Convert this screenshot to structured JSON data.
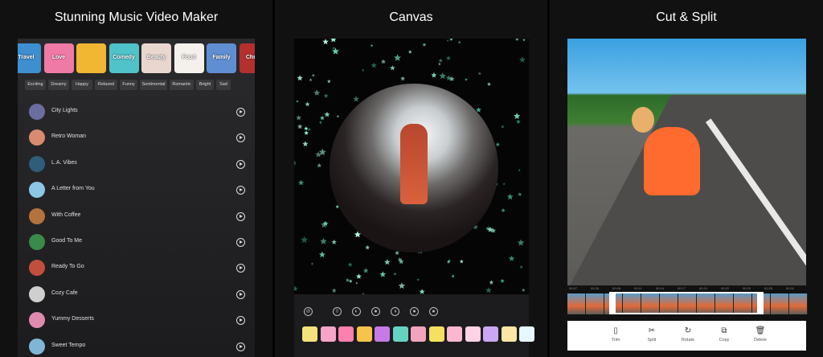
{
  "panels": {
    "music": {
      "title": "Stunning Music Video Maker",
      "categories": [
        {
          "label": "Travel",
          "color": "#3d8fd0"
        },
        {
          "label": "Love",
          "color": "#f07aa6"
        },
        {
          "label": "",
          "color": "#f1b732"
        },
        {
          "label": "Comedy",
          "color": "#4fc3c9"
        },
        {
          "label": "Beauty",
          "color": "#e9d7cf"
        },
        {
          "label": "Food",
          "color": "#f4f1ec"
        },
        {
          "label": "Family",
          "color": "#5f8fd2"
        },
        {
          "label": "Christ",
          "color": "#b52f2f"
        }
      ],
      "moods": [
        "Exciting",
        "Dreamy",
        "Happy",
        "Relaxed",
        "Funny",
        "Sentimental",
        "Romantic",
        "Bright",
        "Sad"
      ],
      "songs": [
        {
          "title": "City Lights",
          "color": "#6a6f9f"
        },
        {
          "title": "Retro Woman",
          "color": "#d98b71"
        },
        {
          "title": "L.A. Vibes",
          "color": "#2f5d7a"
        },
        {
          "title": "A Letter from You",
          "color": "#8cc8e6"
        },
        {
          "title": "With Coffee",
          "color": "#b3733d"
        },
        {
          "title": "Good To Me",
          "color": "#3a8a4a"
        },
        {
          "title": "Ready To Go",
          "color": "#c24f3d"
        },
        {
          "title": "Cozy Cafe",
          "color": "#cfcfcf"
        },
        {
          "title": "Yummy Desserts",
          "color": "#e08ab0"
        },
        {
          "title": "Sweet Tempo",
          "color": "#7fb6d6"
        }
      ]
    },
    "canvas": {
      "title": "Canvas",
      "tools": [
        "none-icon",
        "drop-icon",
        "half-circle-icon",
        "circle-icon",
        "half-moon-icon",
        "dot-icon",
        "dot-icon-2"
      ],
      "swatches": [
        "#f4e27a",
        "#f8a4c8",
        "#ff7fae",
        "#f7c44a",
        "#c779e6",
        "#66d3c2",
        "#f2a3bd",
        "#f5e15e",
        "#fbb7cf",
        "#ffd2e4",
        "#c9a7f2",
        "#fbe6a3",
        "#e7f7ff"
      ]
    },
    "cut": {
      "title": "Cut & Split",
      "timeline_times": [
        "00:07",
        "00:26",
        "00:08",
        "00:11",
        "00:14",
        "00:17",
        "00:19",
        "00:22",
        "00:25",
        "00:28",
        "00:31"
      ],
      "actions": [
        {
          "label": "Trim",
          "icon": "trim-icon",
          "glyph": "▯"
        },
        {
          "label": "Split",
          "icon": "scissors-icon",
          "glyph": "✂"
        },
        {
          "label": "Rotate",
          "icon": "rotate-icon",
          "glyph": "↻"
        },
        {
          "label": "Copy",
          "icon": "copy-icon",
          "glyph": "⧉"
        },
        {
          "label": "Delete",
          "icon": "trash-icon",
          "glyph": "🗑"
        }
      ]
    }
  }
}
